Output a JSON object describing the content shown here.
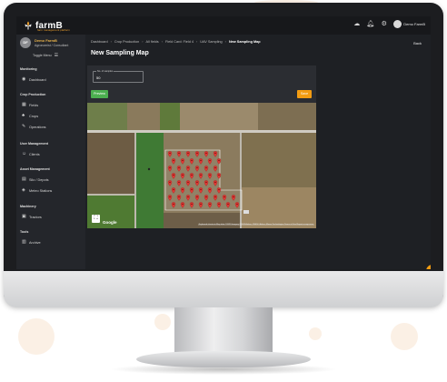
{
  "app": {
    "brand": "farmB",
    "brand_sub": "farm management platform"
  },
  "topbar": {
    "icons": [
      "weather-icon",
      "bell-icon",
      "gear-icon"
    ],
    "user_name": "Demo FarmB"
  },
  "sidebar": {
    "profile": {
      "initials": "DF",
      "name": "Demo FarmB",
      "role": "Agronomist / Consultant"
    },
    "toggle_label": "Toggle Menu",
    "sections": [
      {
        "title": "Monitoring",
        "items": [
          {
            "label": "Dashboard",
            "icon": "dashboard-icon"
          }
        ]
      },
      {
        "title": "Crop Production",
        "items": [
          {
            "label": "Fields",
            "icon": "fields-icon"
          },
          {
            "label": "Crops",
            "icon": "crops-icon"
          },
          {
            "label": "Operations",
            "icon": "operations-icon"
          }
        ]
      },
      {
        "title": "User Management",
        "items": [
          {
            "label": "Clients",
            "icon": "clients-icon"
          }
        ]
      },
      {
        "title": "Asset Management",
        "items": [
          {
            "label": "Silo / Depots",
            "icon": "silo-icon"
          },
          {
            "label": "Meteo Stations",
            "icon": "meteo-icon"
          }
        ]
      },
      {
        "title": "Machinery",
        "items": [
          {
            "label": "Tractors",
            "icon": "tractor-icon"
          }
        ]
      },
      {
        "title": "Tools",
        "items": [
          {
            "label": "Archive",
            "icon": "archive-icon"
          }
        ]
      }
    ]
  },
  "breadcrumb": [
    "Dashboard",
    "Crop Production",
    "All fields",
    "Field Card: Field 4",
    "UAV Sampling",
    "New Sampling Map"
  ],
  "back_label": "Back",
  "page_title": "New Sampling Map",
  "form": {
    "samples_label": "No. of samples",
    "samples_value": "50",
    "preview_label": "Preview",
    "save_label": "Save"
  },
  "map": {
    "google_label": "Google",
    "attribution": "Keyboard shortcuts  Map data ©2023 Imagery ©2023 Airbus, CNES / Airbus, Maxar Technologies  Terms of Use  Report a map error",
    "marker_color": "#e53935",
    "fullscreen_icon": "fullscreen-icon"
  },
  "colors": {
    "accent": "#f39c12",
    "success": "#4caf50",
    "profile_name": "#e8b24a"
  }
}
